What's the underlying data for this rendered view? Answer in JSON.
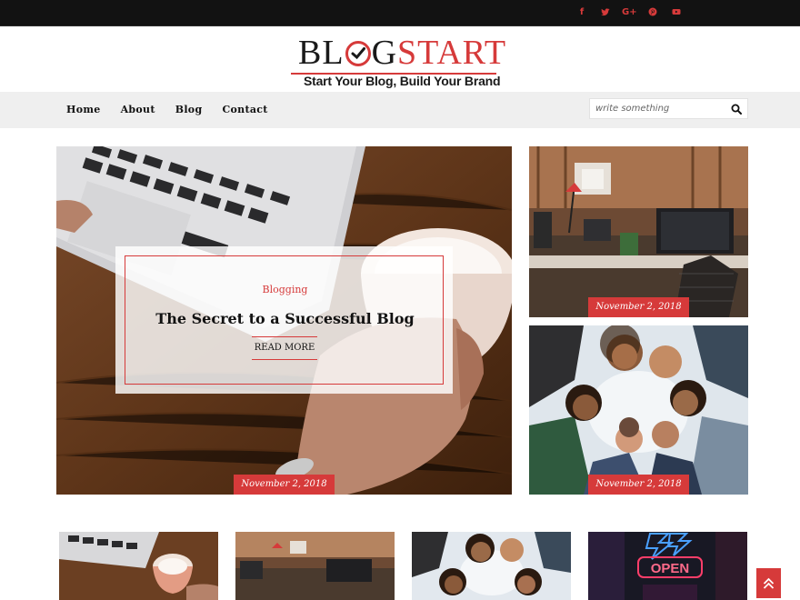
{
  "social": {
    "icons": [
      "facebook-icon",
      "twitter-icon",
      "google-plus-icon",
      "pinterest-icon",
      "youtube-icon"
    ],
    "glyphs": [
      "f",
      "t",
      "G+",
      "p",
      "▶"
    ]
  },
  "brand": {
    "title_left": "BL",
    "title_mid": "G",
    "title_right": "START",
    "tagline": "Start Your Blog, Build Your Brand",
    "accent": "#d63a3a"
  },
  "nav": {
    "items": [
      {
        "label": "Home"
      },
      {
        "label": "About"
      },
      {
        "label": "Blog"
      },
      {
        "label": "Contact"
      }
    ]
  },
  "search": {
    "placeholder": "write something"
  },
  "featured": {
    "category": "Blogging",
    "title": "The Secret to a Successful Blog",
    "button": "READ MORE",
    "date": "November 2, 2018"
  },
  "side_posts": [
    {
      "date": "November 2, 2018"
    },
    {
      "date": "November 2, 2018"
    }
  ],
  "colors": {
    "accent": "#d63a3a",
    "topbar": "#121212",
    "navbar": "#efefef"
  }
}
